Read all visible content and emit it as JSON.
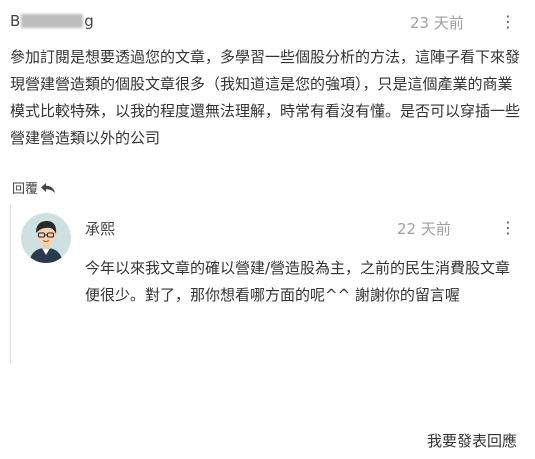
{
  "comment": {
    "author_prefix": "B",
    "author_suffix": "g",
    "time": "23 天前",
    "more": "⋮",
    "body": "參加訂閱是想要透過您的文章，多學習一些個股分析的方法，這陣子看下來發現營建營造類的個股文章很多（我知道這是您的強項），只是這個產業的商業模式比較特殊，以我的程度還無法理解，時常有看沒有懂。是否可以穿插一些營建營造類以外的公司",
    "reply_label": "回覆"
  },
  "reply": {
    "author": "承熙",
    "time": "22 天前",
    "more": "⋮",
    "body": "今年以來我文章的確以營建/營造股為主，之前的民生消費股文章便很少。對了，那你想看哪方面的呢^^ 謝謝你的留言喔"
  },
  "post_reply_label": "我要發表回應"
}
